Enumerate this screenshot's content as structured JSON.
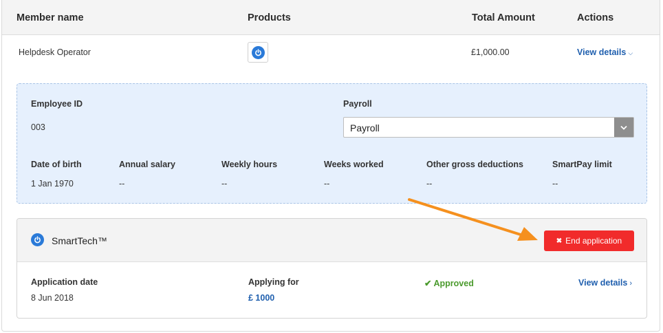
{
  "table": {
    "headers": [
      "Member name",
      "Products",
      "Total Amount",
      "Actions"
    ],
    "row": {
      "member_name": "Helpdesk Operator",
      "product_icon": "power-icon",
      "total_amount": "£1,000.00",
      "action_label": "View details"
    }
  },
  "member_details": {
    "employee_id_label": "Employee ID",
    "employee_id_value": "003",
    "payroll_label": "Payroll",
    "payroll_selected": "Payroll",
    "fields": [
      {
        "label": "Date of birth",
        "value": "1 Jan 1970"
      },
      {
        "label": "Annual salary",
        "value": "--"
      },
      {
        "label": "Weekly hours",
        "value": "--"
      },
      {
        "label": "Weeks worked",
        "value": "--"
      },
      {
        "label": "Other gross deductions",
        "value": "--"
      },
      {
        "label": "SmartPay limit",
        "value": "--"
      }
    ]
  },
  "product_card": {
    "icon": "power-icon",
    "title": "SmartTech™",
    "end_button_label": "End application",
    "application_date_label": "Application date",
    "application_date_value": "8 Jun 2018",
    "applying_for_label": "Applying for",
    "applying_for_value": "£ 1000",
    "status": "Approved",
    "view_details_label": "View details"
  },
  "colors": {
    "accent_blue": "#1f5fae",
    "danger_red": "#f12b2b",
    "success_green": "#4a9a2c",
    "annotation_arrow": "#f5901e",
    "panel_bg": "#e6f0fd"
  }
}
